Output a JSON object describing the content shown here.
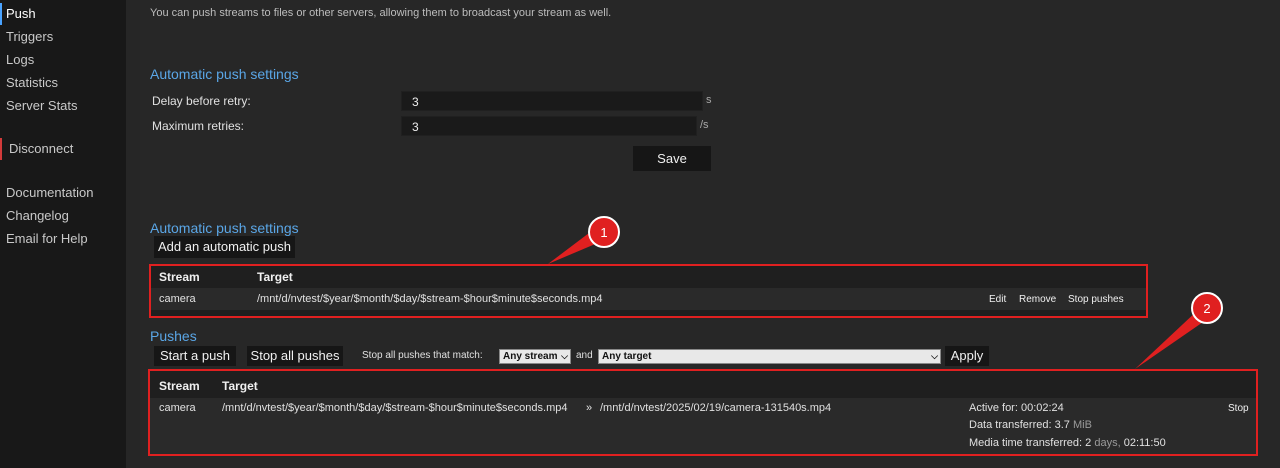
{
  "sidebar": {
    "items": [
      {
        "label": "Push"
      },
      {
        "label": "Triggers"
      },
      {
        "label": "Logs"
      },
      {
        "label": "Statistics"
      },
      {
        "label": "Server Stats"
      },
      {
        "label": "Disconnect"
      },
      {
        "label": "Documentation"
      },
      {
        "label": "Changelog"
      },
      {
        "label": "Email for Help"
      }
    ]
  },
  "intro": "You can push streams to files or other servers, allowing them to broadcast your stream as well.",
  "settings": {
    "heading": "Automatic push settings",
    "delay_label": "Delay before retry:",
    "delay_value": "3",
    "delay_unit": "s",
    "retries_label": "Maximum retries:",
    "retries_value": "3",
    "retries_unit": "/s",
    "save_label": "Save"
  },
  "auto_push": {
    "heading": "Automatic push settings",
    "add_label": "Add an automatic push",
    "columns": [
      "Stream",
      "Target"
    ],
    "rows": [
      {
        "stream": "camera",
        "target": "/mnt/d/nvtest/$year/$month/$day/$stream-$hour$minute$seconds.mp4",
        "actions": [
          "Edit",
          "Remove",
          "Stop pushes"
        ]
      }
    ]
  },
  "pushes": {
    "heading": "Pushes",
    "start_label": "Start a push",
    "stop_all_label": "Stop all pushes",
    "filter_label": "Stop all pushes that match:",
    "stream_select": "Any stream",
    "and_label": "and",
    "target_select": "Any target",
    "apply_label": "Apply",
    "columns": [
      "Stream",
      "Target"
    ],
    "rows": [
      {
        "stream": "camera",
        "target": "/mnt/d/nvtest/$year/$month/$day/$stream-$hour$minute$seconds.mp4",
        "arrow": "»",
        "resolved": "/mnt/d/nvtest/2025/02/19/camera-131540s.mp4",
        "active_label": "Active for:",
        "active_value": "00:02:24",
        "data_label": "Data transferred:",
        "data_value": "3.7",
        "data_unit": "MiB",
        "media_label": "Media time transferred:",
        "media_days": "2",
        "media_days_unit": "days,",
        "media_time": "02:11:50",
        "action": "Stop"
      }
    ]
  },
  "callouts": [
    "1",
    "2"
  ],
  "colors": {
    "accent": "#5aa6e6",
    "annotation": "#e02020"
  }
}
